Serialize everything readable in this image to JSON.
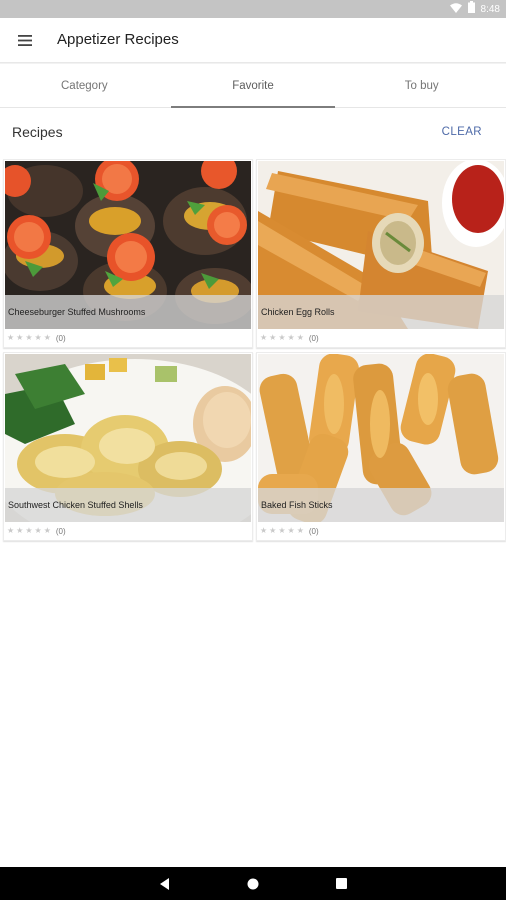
{
  "status_bar": {
    "time": "8:48",
    "icons": [
      "wifi-icon",
      "battery-icon"
    ]
  },
  "app_bar": {
    "title": "Appetizer Recipes",
    "menu_icon": "hamburger-menu-icon"
  },
  "tabs": [
    {
      "label": "Category",
      "active": false
    },
    {
      "label": "Favorite",
      "active": true
    },
    {
      "label": "To buy",
      "active": false
    }
  ],
  "section": {
    "title": "Recipes",
    "clear_label": "CLEAR"
  },
  "recipes": [
    {
      "name": "Cheeseburger Stuffed Mushrooms",
      "rating_count": "(0)",
      "stars": 0
    },
    {
      "name": "Chicken Egg Rolls",
      "rating_count": "(0)",
      "stars": 0
    },
    {
      "name": "Southwest Chicken Stuffed Shells",
      "rating_count": "(0)",
      "stars": 0
    },
    {
      "name": "Baked Fish Sticks",
      "rating_count": "(0)",
      "stars": 0
    }
  ],
  "nav_bar": {
    "icons": [
      "back-icon",
      "home-icon",
      "recents-icon"
    ]
  }
}
